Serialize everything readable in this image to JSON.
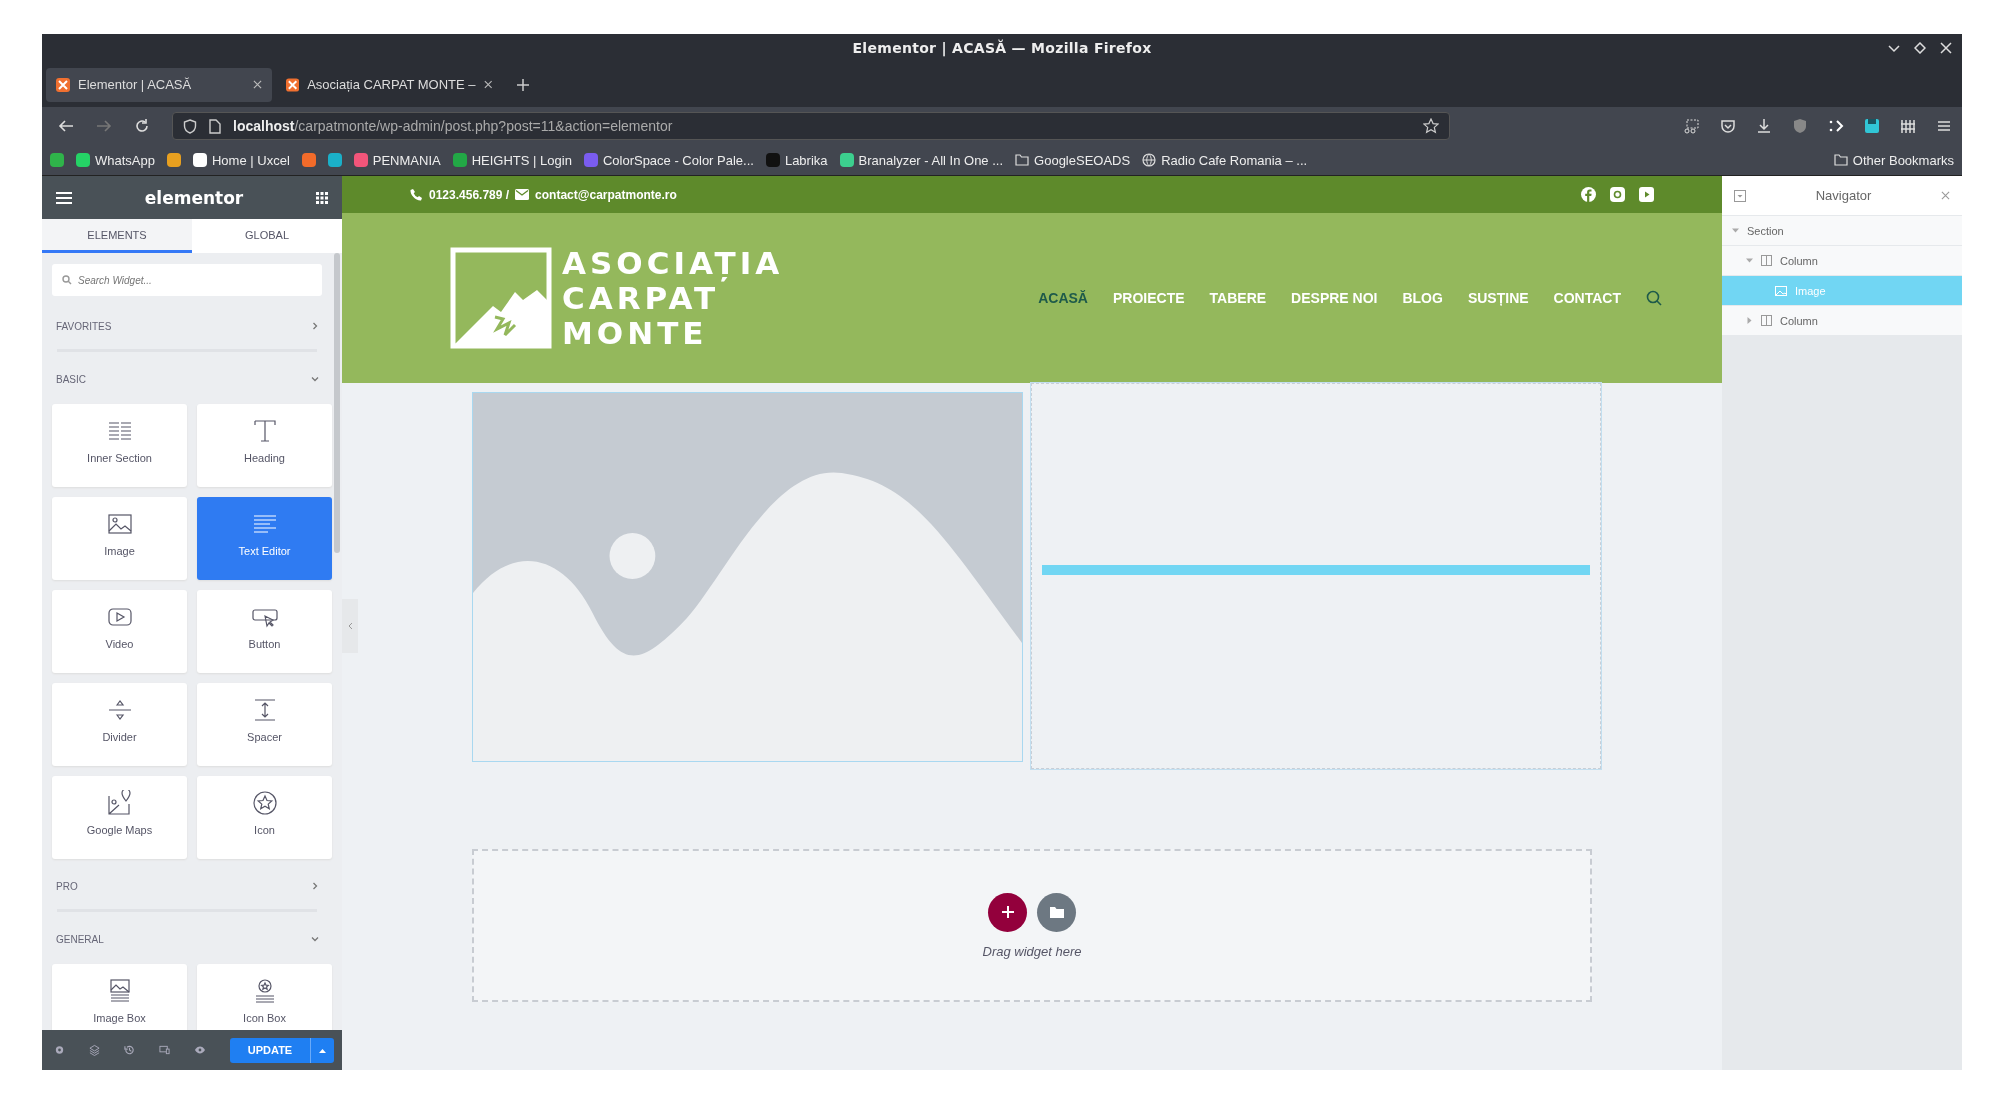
{
  "window": {
    "title": "Elementor | ACASĂ — Mozilla Firefox"
  },
  "tabs": [
    {
      "title": "Elementor | ACASĂ",
      "selected": true
    },
    {
      "title": "Asociația CARPAT MONTE –",
      "selected": false
    }
  ],
  "url": {
    "host": "localhost",
    "path": "/carpatmonte/wp-admin/post.php?post=11&action=elementor"
  },
  "bookmarks": [
    {
      "kind": "favicon",
      "color": "#2fb34a"
    },
    {
      "kind": "favicon",
      "color": "#25d366",
      "label": "WhatsApp"
    },
    {
      "kind": "favicon",
      "color": "#e8a020"
    },
    {
      "kind": "favicon",
      "color": "#ffffff",
      "label": "Home | Uxcel"
    },
    {
      "kind": "favicon",
      "color": "#f26b2a"
    },
    {
      "kind": "favicon",
      "color": "#1ab0c9"
    },
    {
      "kind": "favicon",
      "color": "#f2557a",
      "label": "PENMANIA"
    },
    {
      "kind": "favicon",
      "color": "#22a846",
      "label": "HEIGHTS | Login"
    },
    {
      "kind": "favicon",
      "color": "#7a5cf0",
      "label": "ColorSpace - Color Pale..."
    },
    {
      "kind": "favicon",
      "color": "#111111",
      "label": "Labrika"
    },
    {
      "kind": "favicon",
      "color": "#3ccf8e",
      "label": "Branalyzer - All In One ..."
    },
    {
      "kind": "folder",
      "label": "GoogleSEOADS"
    },
    {
      "kind": "globe",
      "label": "Radio Cafe Romania – ..."
    }
  ],
  "other_bookmarks": "Other Bookmarks",
  "panel": {
    "brand": "elementor",
    "tabs": [
      {
        "label": "ELEMENTS",
        "selected": true
      },
      {
        "label": "GLOBAL",
        "selected": false
      }
    ],
    "search": {
      "placeholder": "Search Widget..."
    },
    "categories": [
      {
        "name": "FAVORITES",
        "expanded": false
      },
      {
        "name": "BASIC",
        "expanded": true,
        "widgets": [
          {
            "kind": "inner-section",
            "label": "Inner Section",
            "selected": false
          },
          {
            "kind": "heading",
            "label": "Heading",
            "selected": false
          },
          {
            "kind": "image",
            "label": "Image",
            "selected": false
          },
          {
            "kind": "text-editor",
            "label": "Text Editor",
            "selected": true
          },
          {
            "kind": "video",
            "label": "Video",
            "selected": false
          },
          {
            "kind": "button",
            "label": "Button",
            "selected": false
          },
          {
            "kind": "divider",
            "label": "Divider",
            "selected": false
          },
          {
            "kind": "spacer",
            "label": "Spacer",
            "selected": false
          },
          {
            "kind": "map",
            "label": "Google Maps",
            "selected": false
          },
          {
            "kind": "icon",
            "label": "Icon",
            "selected": false
          }
        ]
      },
      {
        "name": "PRO",
        "expanded": false
      },
      {
        "name": "GENERAL",
        "expanded": true,
        "widgets": [
          {
            "kind": "image-box",
            "label": "Image Box",
            "selected": false
          },
          {
            "kind": "icon-box",
            "label": "Icon Box",
            "selected": false
          }
        ]
      }
    ],
    "update_button": "UPDATE"
  },
  "site": {
    "phone": "0123.456.789 /",
    "email": "contact@carpatmonte.ro",
    "logo": [
      "ASOCIAȚIA",
      "CARPAT",
      "MONTE"
    ],
    "nav": [
      {
        "label": "ACASĂ",
        "selected": true
      },
      {
        "label": "PROIECTE",
        "selected": false
      },
      {
        "label": "TABERE",
        "selected": false
      },
      {
        "label": "DESPRE NOI",
        "selected": false
      },
      {
        "label": "BLOG",
        "selected": false
      },
      {
        "label": "SUSȚINE",
        "selected": false
      },
      {
        "label": "CONTACT",
        "selected": false
      }
    ],
    "drop_hint": "Drag widget here"
  },
  "navigator": {
    "title": "Navigator",
    "tree": [
      {
        "label": "Section",
        "expanded": true,
        "selected": false,
        "children": [
          {
            "label": "Column",
            "kind": "column",
            "expanded": true,
            "selected": false,
            "children": [
              {
                "label": "Image",
                "kind": "image",
                "selected": true
              }
            ]
          },
          {
            "label": "Column",
            "kind": "column",
            "expanded": false,
            "selected": false
          }
        ]
      }
    ]
  }
}
